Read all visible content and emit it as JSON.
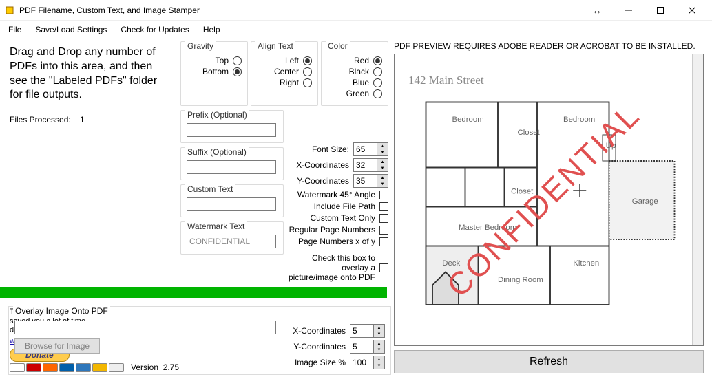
{
  "window": {
    "title": "PDF Filename, Custom Text, and Image Stamper"
  },
  "menu": {
    "file": "File",
    "saveload": "Save/Load Settings",
    "updates": "Check for Updates",
    "help": "Help"
  },
  "left": {
    "intro": "Drag and Drop any number of PDFs into this area, and then see the \"Labeled PDFs\" folder for file outputs.",
    "files_label": "Files Processed:",
    "files_count": "1",
    "freeline1": "This program is free, but if it",
    "freeline2": "saved you a lot of time,",
    "freeline3": "donations are welcome :)",
    "link": "www.saintjohnny.com",
    "donate": "Donate",
    "version_label": "Version",
    "version": "2.75"
  },
  "groups": {
    "gravity": {
      "label": "Gravity",
      "top": "Top",
      "bottom": "Bottom",
      "selected": "bottom"
    },
    "align": {
      "label": "Align Text",
      "left": "Left",
      "center": "Center",
      "right": "Right",
      "selected": "left"
    },
    "color": {
      "label": "Color",
      "red": "Red",
      "black": "Black",
      "blue": "Blue",
      "green": "Green",
      "selected": "red"
    },
    "prefix": {
      "label": "Prefix (Optional)",
      "value": ""
    },
    "suffix": {
      "label": "Suffix (Optional)",
      "value": ""
    },
    "custom": {
      "label": "Custom Text",
      "value": ""
    },
    "watermark": {
      "label": "Watermark Text",
      "value": "CONFIDENTIAL"
    }
  },
  "opts": {
    "font_label": "Font Size:",
    "font_value": "65",
    "x_label": "X-Coordinates",
    "x_value": "32",
    "y_label": "Y-Coordinates",
    "y_value": "35",
    "angle": "Watermark 45° Angle",
    "includepath": "Include File Path",
    "ctonly": "Custom Text Only",
    "regpages": "Regular Page Numbers",
    "pxy": "Page Numbers x of y",
    "overlaychk1": "Check this box to overlay a",
    "overlaychk2": "picture/image onto PDF"
  },
  "overlay": {
    "label": "Overlay Image Onto PDF",
    "path": "",
    "browse": "Browse for Image",
    "x_label": "X-Coordinates",
    "x_value": "5",
    "y_label": "Y-Coordinates",
    "y_value": "5",
    "size_label": "Image Size %",
    "size_value": "100"
  },
  "preview": {
    "msg": "PDF PREVIEW REQUIRES ADOBE READER OR ACROBAT TO BE INSTALLED.",
    "title": "142 Main Street",
    "watermark": "CONFIDENTIAL",
    "rooms": {
      "bedroom": "Bedroom",
      "bedroom2": "Bedroom",
      "closet": "Closet",
      "closet2": "Closet",
      "up": "Up",
      "garage": "Garage",
      "master": "Master Bedroom",
      "deck": "Deck",
      "dining": "Dining Room",
      "kitchen": "Kitchen"
    },
    "refresh": "Refresh"
  }
}
